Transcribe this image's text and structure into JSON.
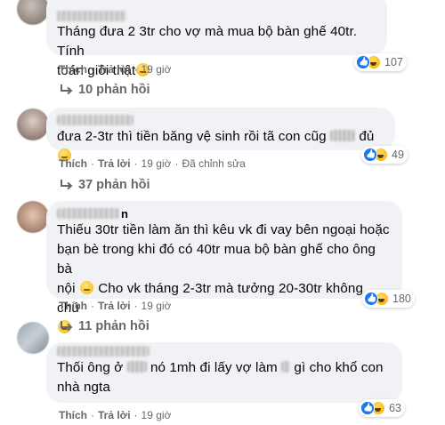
{
  "comments": [
    {
      "text_a": "Tháng đưa 2 3tr cho vợ mà mua bộ bàn ghế 40tr. Tính",
      "text_b": "toán giỏi thật",
      "like": "Thích",
      "reply": "Trả lời",
      "time": "19 giờ",
      "reaction_count": "107",
      "replies": "10 phản hồi"
    },
    {
      "text_a": "đưa 2-3tr thì tiền băng vệ sinh rồi tã con cũg",
      "text_b": "đủ",
      "like": "Thích",
      "reply": "Trả lời",
      "time": "19 giờ",
      "edited": "Đã chỉnh sửa",
      "reaction_count": "49",
      "replies": "37 phản hồi"
    },
    {
      "name_visible": "n",
      "line1": "Thiếu 30tr tiền làm ăn thì kêu vk đi vay bên ngoại hoặc",
      "line2": "bạn bè trong khi đó có 40tr mua bộ bàn ghế cho ông bà",
      "line3a": "nội",
      "line3b": "Cho vk tháng 2-3tr mà tưởng 20-30tr không chứ",
      "like": "Thích",
      "reply": "Trả lời",
      "time": "19 giờ",
      "reaction_count": "180",
      "replies": "11 phản hồi"
    },
    {
      "line1a": "Thối ông ở",
      "line1b": "nó 1mh đi lấy vợ làm",
      "line1c": "gì cho khổ con",
      "line2": "nhà ngta",
      "like": "Thích",
      "reply": "Trả lời",
      "time": "19 giờ",
      "reaction_count": "63"
    }
  ]
}
